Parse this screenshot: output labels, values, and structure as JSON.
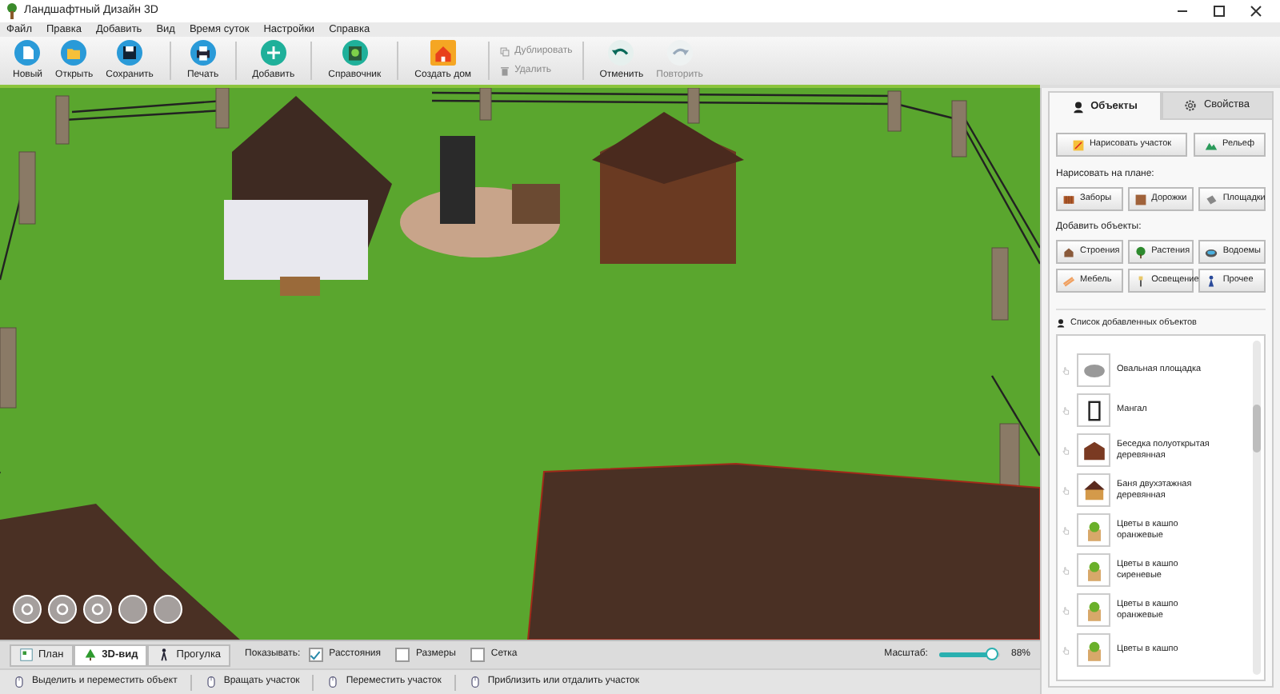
{
  "window": {
    "title": "Ландшафтный Дизайн 3D"
  },
  "menu": [
    "Файл",
    "Правка",
    "Добавить",
    "Вид",
    "Время суток",
    "Настройки",
    "Справка"
  ],
  "toolbar": [
    {
      "kind": "big",
      "label": "Новый",
      "disabled": false
    },
    {
      "kind": "big",
      "label": "Открыть",
      "disabled": false
    },
    {
      "kind": "big",
      "label": "Сохранить",
      "disabled": false
    },
    {
      "kind": "sep"
    },
    {
      "kind": "big",
      "label": "Печать",
      "disabled": false
    },
    {
      "kind": "sep"
    },
    {
      "kind": "big",
      "label": "Добавить",
      "disabled": false
    },
    {
      "kind": "sep"
    },
    {
      "kind": "big",
      "label": "Справочник",
      "disabled": false
    },
    {
      "kind": "sep"
    },
    {
      "kind": "big",
      "label": "Создать дом",
      "disabled": false
    },
    {
      "kind": "sep"
    },
    {
      "kind": "pair",
      "items": [
        {
          "label": "Дублировать",
          "disabled": true
        },
        {
          "label": "Удалить",
          "disabled": true
        }
      ]
    },
    {
      "kind": "sep"
    },
    {
      "kind": "big",
      "label": "Отменить",
      "disabled": false
    },
    {
      "kind": "big",
      "label": "Повторить",
      "disabled": true
    }
  ],
  "panel": {
    "tabs": [
      {
        "label": "Объекты",
        "selected": true
      },
      {
        "label": "Свойства",
        "selected": false
      }
    ],
    "top_buttons": [
      "Нарисовать участок",
      "Рельеф"
    ],
    "draw_heading": "Нарисовать на плане:",
    "draw_buttons": [
      "Заборы",
      "Дорожки",
      "Площадки"
    ],
    "add_heading": "Добавить объекты:",
    "add_buttons": [
      "Строения",
      "Растения",
      "Водоемы",
      "Мебель",
      "Освещение",
      "Прочее"
    ],
    "list_heading": "Список добавленных объектов",
    "list": [
      "Овальная площадка",
      "Мангал",
      "Беседка полуоткрытая деревянная",
      "Баня двухэтажная деревянная",
      "Цветы в кашпо оранжевые",
      "Цветы в кашпо сиреневые",
      "Цветы в кашпо оранжевые",
      "Цветы в кашпо"
    ]
  },
  "view_bar": {
    "modes": [
      {
        "label": "План",
        "selected": false
      },
      {
        "label": "3D-вид",
        "selected": true
      },
      {
        "label": "Прогулка",
        "selected": false
      }
    ],
    "show_label": "Показывать:",
    "options": [
      {
        "label": "Расстояния",
        "checked": true
      },
      {
        "label": "Размеры",
        "checked": false
      },
      {
        "label": "Сетка",
        "checked": false
      }
    ],
    "zoom_label": "Масштаб:",
    "zoom": {
      "level": 0.88
    },
    "zoom_reading": "88%"
  },
  "status_bar": [
    "Выделить и переместить объект",
    "Вращать участок",
    "Переместить участок",
    "Приблизить или отдалить участок"
  ]
}
